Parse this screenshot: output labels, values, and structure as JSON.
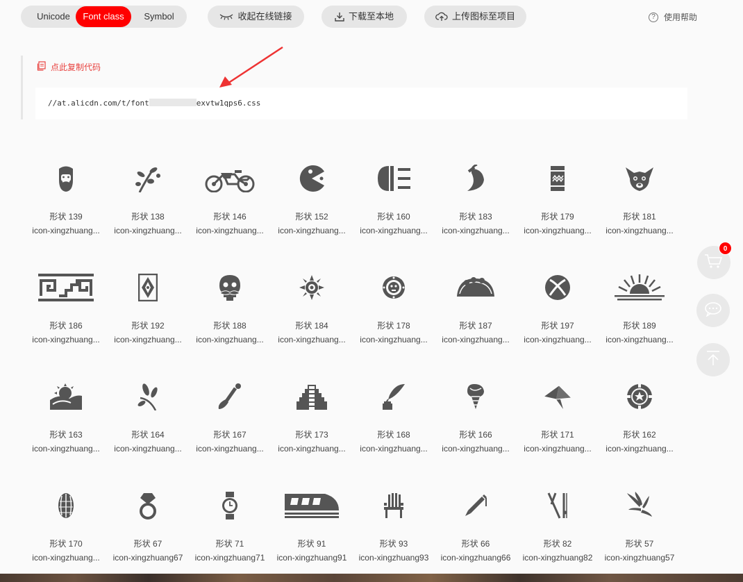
{
  "toolbar": {
    "tabs": [
      {
        "label": "Unicode"
      },
      {
        "label": "Font class",
        "active": true
      },
      {
        "label": "Symbol"
      }
    ],
    "collapse_link_label": "收起在线链接",
    "download_label": "下载至本地",
    "upload_label": "上传图标至项目",
    "help_label": "使用帮助"
  },
  "code_panel": {
    "copy_label": "点此复制代码",
    "url_prefix": "//at.alicdn.com/t/font",
    "url_suffix": "exvtw1qps6.css"
  },
  "icons": [
    {
      "name": "形状 139",
      "cls": "icon-xingzhuang...",
      "icon": "bearded-face-icon"
    },
    {
      "name": "形状 138",
      "cls": "icon-xingzhuang...",
      "icon": "plant-branch-icon"
    },
    {
      "name": "形状 146",
      "cls": "icon-xingzhuang...",
      "icon": "motorcycle-icon"
    },
    {
      "name": "形状 152",
      "cls": "icon-xingzhuang...",
      "icon": "pacman-icon"
    },
    {
      "name": "形状 160",
      "cls": "icon-xingzhuang...",
      "icon": "headlight-icon"
    },
    {
      "name": "形状 183",
      "cls": "icon-xingzhuang...",
      "icon": "chili-pepper-icon"
    },
    {
      "name": "形状 179",
      "cls": "icon-xingzhuang...",
      "icon": "rug-icon"
    },
    {
      "name": "形状 181",
      "cls": "icon-xingzhuang...",
      "icon": "chihuahua-icon"
    },
    {
      "name": "形状 186",
      "cls": "icon-xingzhuang...",
      "icon": "greek-pattern-icon"
    },
    {
      "name": "形状 192",
      "cls": "icon-xingzhuang...",
      "icon": "diamond-pattern-icon"
    },
    {
      "name": "形状 188",
      "cls": "icon-xingzhuang...",
      "icon": "skull-mustache-icon"
    },
    {
      "name": "形状 184",
      "cls": "icon-xingzhuang...",
      "icon": "aztec-sun-icon"
    },
    {
      "name": "形状 178",
      "cls": "icon-xingzhuang...",
      "icon": "calendar-stone-icon"
    },
    {
      "name": "形状 187",
      "cls": "icon-xingzhuang...",
      "icon": "taco-icon"
    },
    {
      "name": "形状 197",
      "cls": "icon-xingzhuang...",
      "icon": "xbox-icon"
    },
    {
      "name": "形状 189",
      "cls": "icon-xingzhuang...",
      "icon": "sunrise-icon"
    },
    {
      "name": "形状 163",
      "cls": "icon-xingzhuang...",
      "icon": "sun-hill-icon"
    },
    {
      "name": "形状 164",
      "cls": "icon-xingzhuang...",
      "icon": "leaves-icon"
    },
    {
      "name": "形状 167",
      "cls": "icon-xingzhuang...",
      "icon": "brush-icon"
    },
    {
      "name": "形状 173",
      "cls": "icon-xingzhuang...",
      "icon": "pyramid-icon"
    },
    {
      "name": "形状 168",
      "cls": "icon-xingzhuang...",
      "icon": "quill-ink-icon"
    },
    {
      "name": "形状 166",
      "cls": "icon-xingzhuang...",
      "icon": "ice-cream-cone-icon"
    },
    {
      "name": "形状 171",
      "cls": "icon-xingzhuang...",
      "icon": "paper-plane-icon"
    },
    {
      "name": "形状 162",
      "cls": "icon-xingzhuang...",
      "icon": "poker-chip-icon"
    },
    {
      "name": "形状 170",
      "cls": "icon-xingzhuang...",
      "icon": "cocoa-pod-icon"
    },
    {
      "name": "形状 67",
      "cls": "icon-xingzhuang67",
      "icon": "ring-icon"
    },
    {
      "name": "形状 71",
      "cls": "icon-xingzhuang71",
      "icon": "watch-icon"
    },
    {
      "name": "形状 91",
      "cls": "icon-xingzhuang91",
      "icon": "train-icon"
    },
    {
      "name": "形状 93",
      "cls": "icon-xingzhuang93",
      "icon": "chair-icon"
    },
    {
      "name": "形状 66",
      "cls": "icon-xingzhuang66",
      "icon": "pen-icon"
    },
    {
      "name": "形状 82",
      "cls": "icon-xingzhuang82",
      "icon": "skis-icon"
    },
    {
      "name": "形状 57",
      "cls": "icon-xingzhuang57",
      "icon": "wing-icon"
    }
  ],
  "cart_badge": "0",
  "colors": {
    "accent": "#ff0000",
    "icon": "#555555",
    "copy_link": "#e8423f"
  }
}
